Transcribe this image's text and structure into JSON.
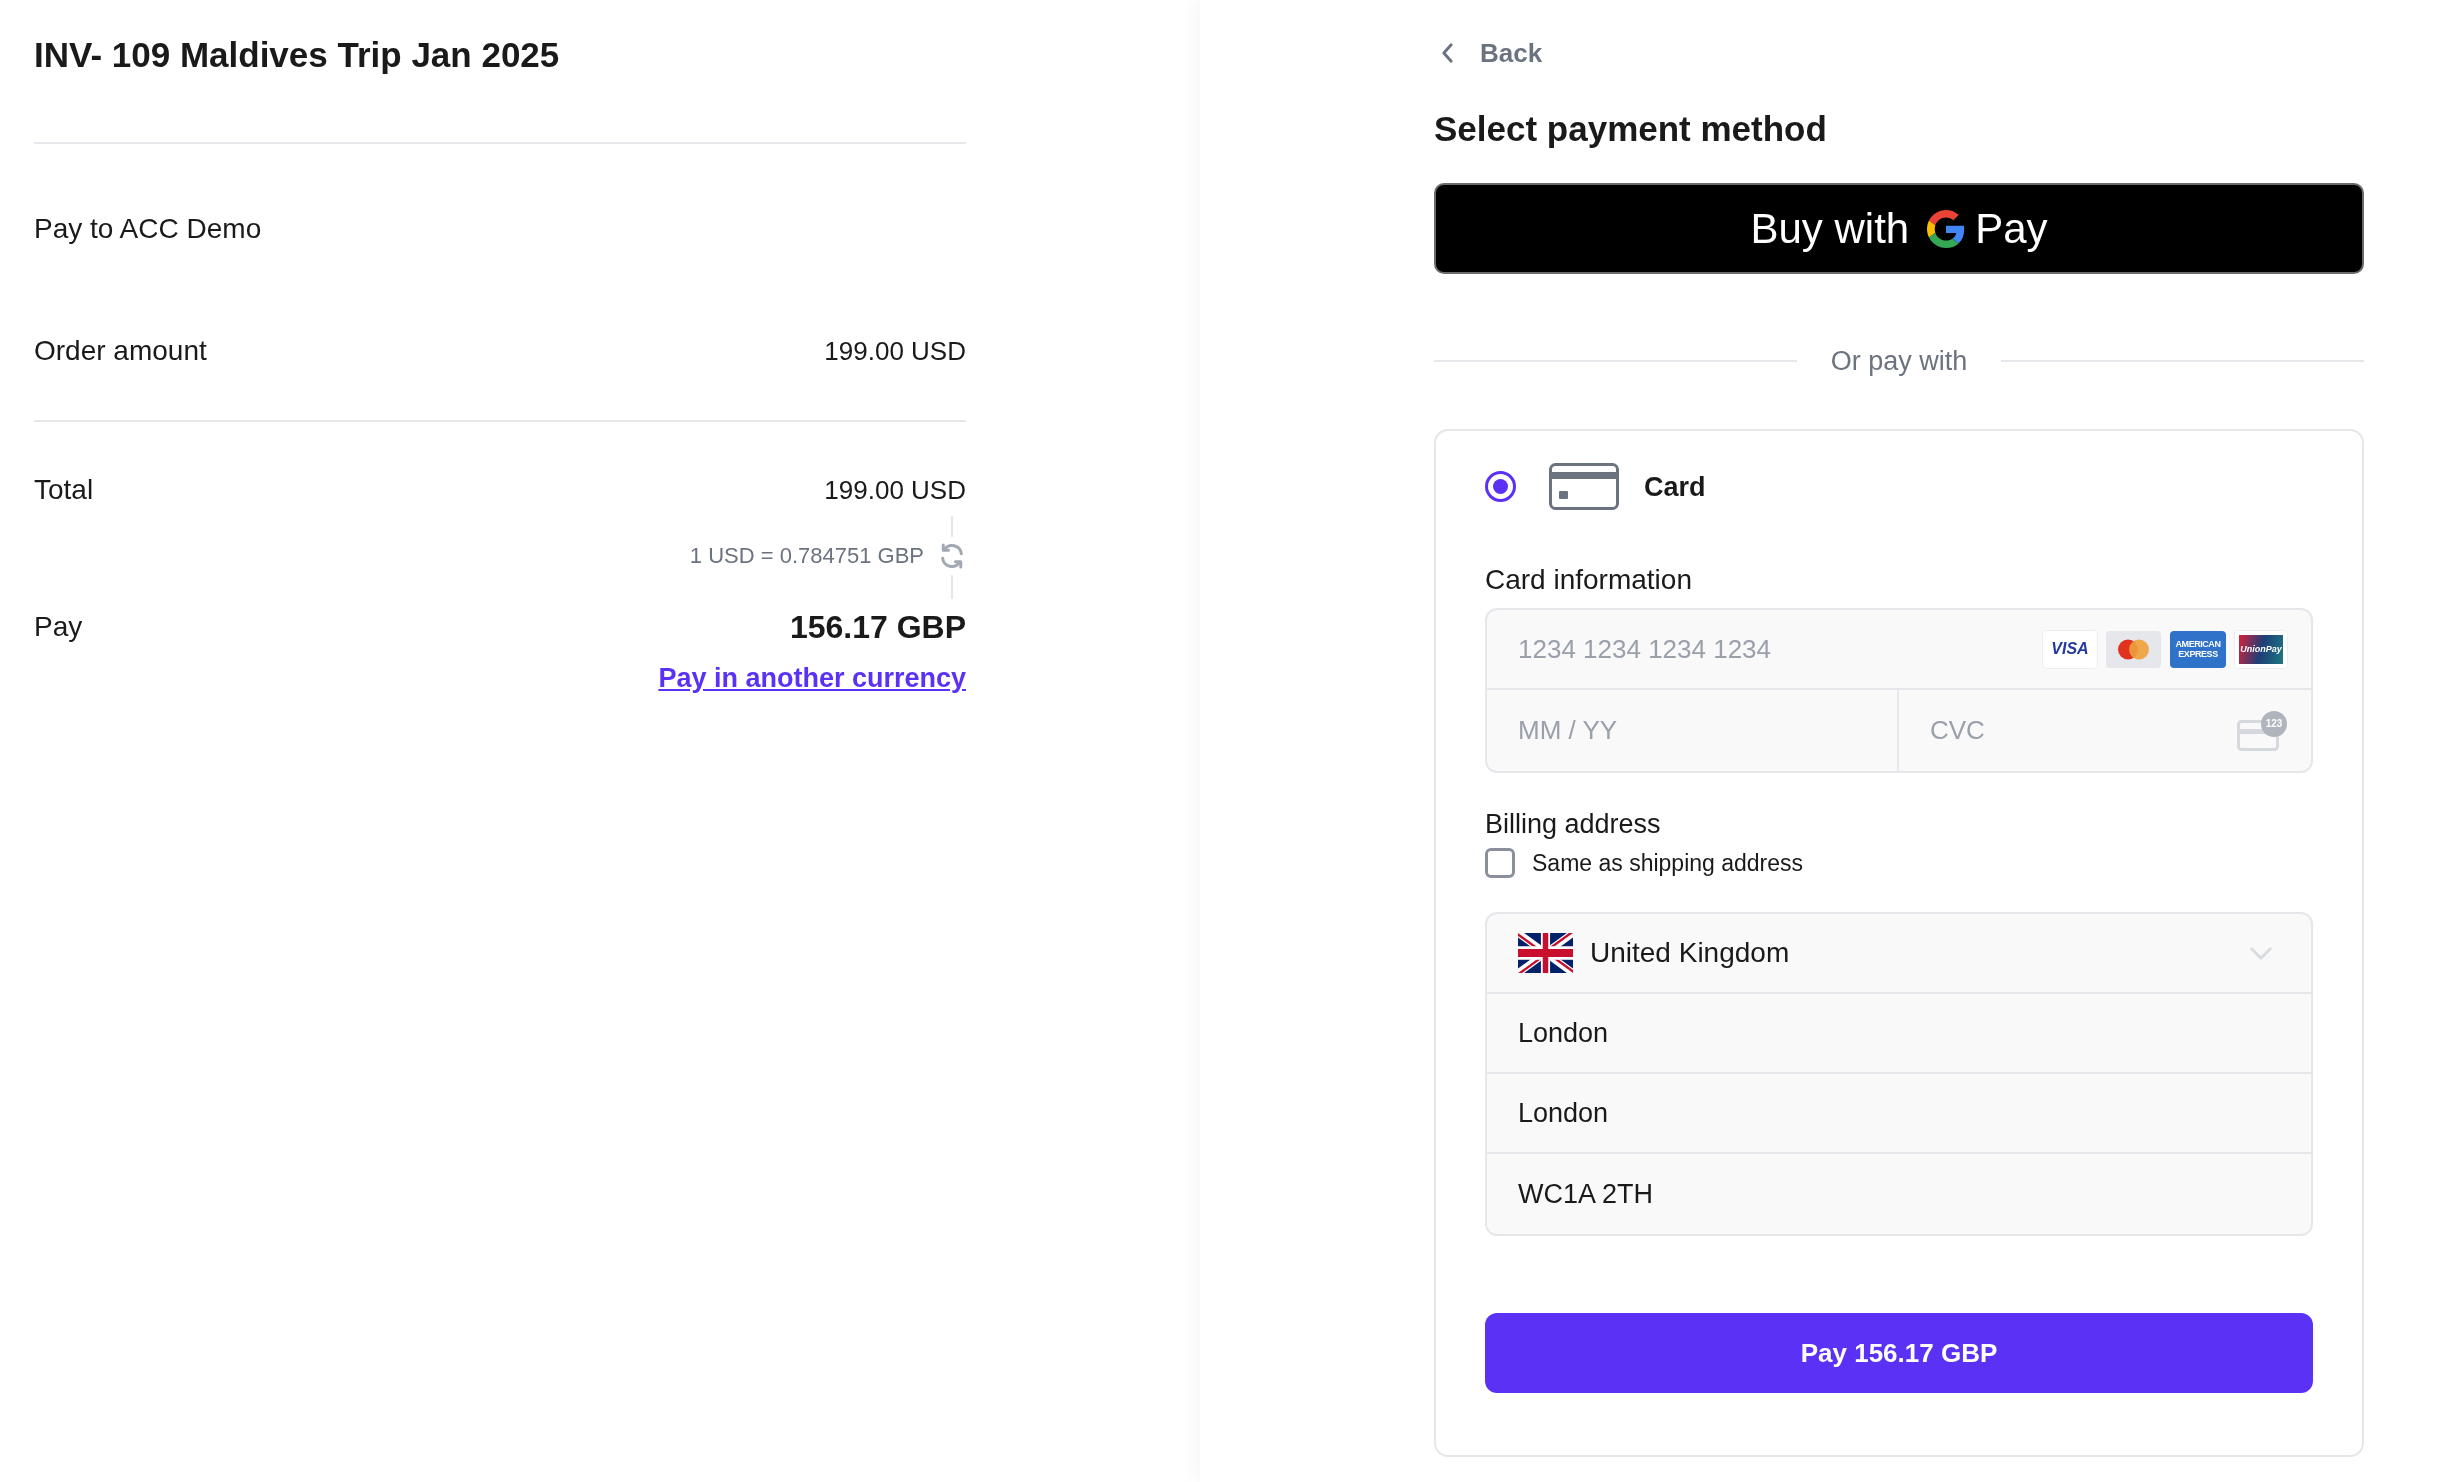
{
  "invoice": {
    "title": "INV- 109 Maldives Trip Jan 2025",
    "payee": "Pay to ACC Demo",
    "order_amount": {
      "label": "Order amount",
      "value": "199.00 USD"
    },
    "total": {
      "label": "Total",
      "value": "199.00 USD"
    },
    "exchange_rate": "1 USD = 0.784751 GBP",
    "pay": {
      "label": "Pay",
      "value": "156.17 GBP"
    },
    "currency_link": "Pay in another currency"
  },
  "checkout": {
    "back": "Back",
    "title": "Select payment method",
    "google_pay_button": {
      "prefix": "Buy with",
      "suffix": "Pay"
    },
    "divider": "Or pay with",
    "methods": [
      {
        "kind": "card",
        "label": "Card",
        "selected": true
      }
    ],
    "card_information": {
      "label": "Card information",
      "number": {
        "placeholder": "1234 1234 1234 1234"
      },
      "brands": [
        {
          "kind": "visa",
          "label": "VISA"
        },
        {
          "kind": "mastercard"
        },
        {
          "kind": "amex",
          "label": "AMERICAN EXPRESS"
        },
        {
          "kind": "unionpay",
          "label": "UnionPay"
        }
      ],
      "expiry": {
        "placeholder": "MM / YY"
      },
      "cvc": {
        "placeholder": "CVC",
        "hint": "123"
      }
    },
    "billing_address": {
      "label": "Billing address",
      "same_as_shipping": {
        "label": "Same as shipping address",
        "checked": false
      },
      "country": {
        "value": "United Kingdom"
      },
      "fields": [
        {
          "value": "London"
        },
        {
          "value": "London"
        },
        {
          "value": "WC1A 2TH"
        }
      ]
    },
    "pay_button": "Pay 156.17 GBP"
  }
}
